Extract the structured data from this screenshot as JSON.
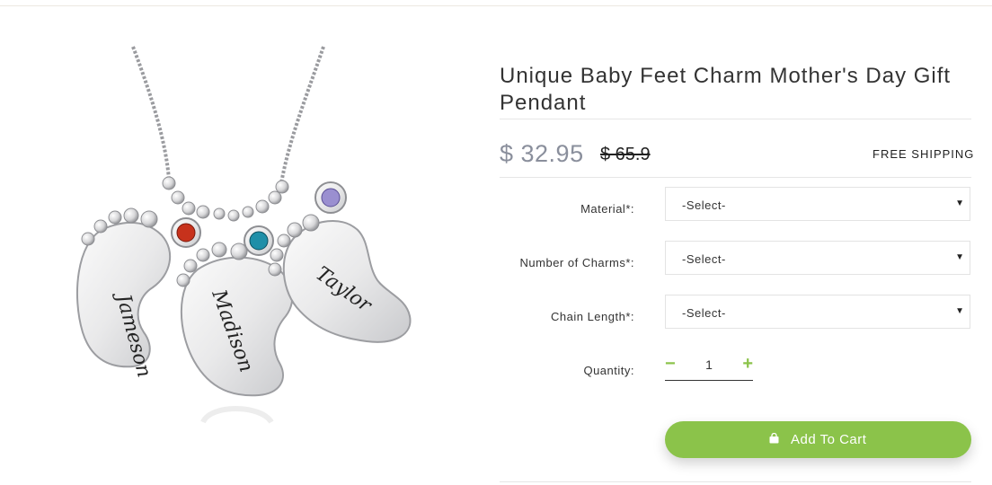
{
  "product": {
    "title": "Unique Baby Feet Charm Mother's Day Gift Pendant",
    "image_alt": "Baby feet charm necklace engraved Jameson, Madison, Taylor",
    "engravings": [
      "Jameson",
      "Madison",
      "Taylor"
    ]
  },
  "price": {
    "current": "$ 32.95",
    "original": "$ 65.9",
    "shipping": "FREE SHIPPING"
  },
  "options": [
    {
      "label": "Material*:",
      "value": "-Select-"
    },
    {
      "label": "Number of Charms*:",
      "value": "-Select-"
    },
    {
      "label": "Chain Length*:",
      "value": "-Select-"
    }
  ],
  "quantity": {
    "label": "Quantity:",
    "value": "1",
    "minus": "−",
    "plus": "+"
  },
  "cart": {
    "label": "Add To Cart"
  },
  "colors": {
    "accent": "#8bc34a",
    "price": "#8a8f9c"
  }
}
